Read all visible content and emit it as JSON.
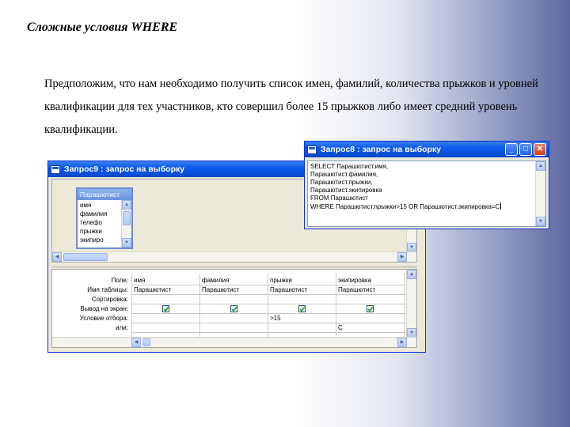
{
  "slide": {
    "title": "Сложные условия WHERE",
    "text": "Предположим, что нам необходимо получить список имен, фамилий, количества прыжков и уровней квалификации для тех участников, кто совершил более 15 прыжков либо имеет средний уровень квалификации."
  },
  "query_window": {
    "title": "Запрос9 : запрос на выборку",
    "field_list": {
      "title": "Парашютист",
      "items": [
        "имя",
        "фамилия",
        "телефо",
        "прыжки",
        "экипиро"
      ]
    },
    "grid": {
      "row_labels": [
        "Поле:",
        "Имя таблицы:",
        "Сортировка:",
        "Вывод на экран:",
        "Условие отбора:",
        "или:"
      ],
      "columns": [
        {
          "field": "имя",
          "table": "Парашютист",
          "show": true,
          "criteria": "",
          "or": ""
        },
        {
          "field": "фамилия",
          "table": "Парашютист",
          "show": true,
          "criteria": "",
          "or": ""
        },
        {
          "field": "прыжки",
          "table": "Парашютист",
          "show": true,
          "criteria": ">15",
          "or": ""
        },
        {
          "field": "экипировка",
          "table": "Парашютист",
          "show": true,
          "criteria": "",
          "or": "С"
        }
      ]
    }
  },
  "sql_window": {
    "title": "Запрос8 : запрос на выборку",
    "lines": [
      "SELECT Парашютист.имя,",
      "Парашютист.фамилия,",
      "Парашютист.прыжки,",
      "Парашютист.экипировка",
      "FROM Парашютист",
      "WHERE Парашютист.прыжки>15 OR Парашютист.экипировка=С"
    ]
  },
  "colors": {
    "titlebar": "#0a4fd6",
    "window_bg": "#ece9d8",
    "check": "#21a121"
  },
  "icons": [
    "window-icon",
    "minimize-icon",
    "maximize-icon",
    "close-icon",
    "scroll-up-icon",
    "scroll-down-icon",
    "scroll-left-icon",
    "scroll-right-icon",
    "checkbox-icon"
  ]
}
